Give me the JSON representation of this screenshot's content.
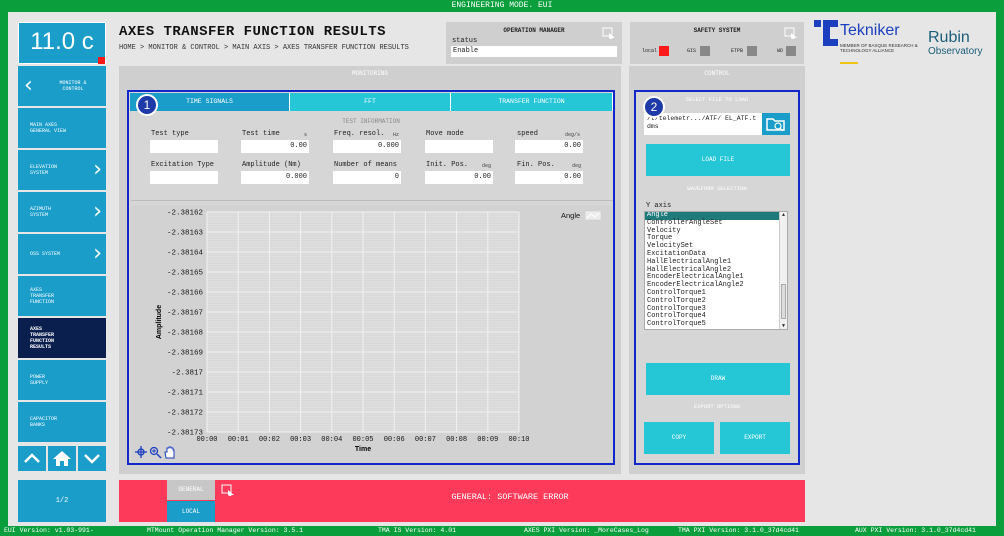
{
  "top_bar": {
    "title": "ENGINEERING MODE. EUI"
  },
  "temperature": {
    "value": "11.0 c"
  },
  "nav": {
    "items": [
      {
        "label": "MONITOR & CONTROL",
        "chevron_left": true
      },
      {
        "label": "MAIN AXES GENERAL VIEW"
      },
      {
        "label": "ELEVATION SYSTEM",
        "chevron": true
      },
      {
        "label": "AZIMUTH SYSTEM",
        "chevron": true
      },
      {
        "label": "OSS SYSTEM",
        "chevron": true
      },
      {
        "label": "AXES TRANSFER FUNCTION"
      },
      {
        "label": "AXES TRANSFER FUNCTION RESULTS",
        "active": true
      },
      {
        "label": "POWER SUPPLY"
      },
      {
        "label": "CAPACITOR BANKS"
      }
    ],
    "page_indicator": "1/2"
  },
  "header": {
    "title": "AXES TRANSFER FUNCTION RESULTS",
    "breadcrumb": "HOME > MONITOR & CONTROL > MAIN AXIS > AXES TRANSFER FUNCTION RESULTS"
  },
  "operation_manager": {
    "title": "OPERATION MANAGER",
    "status_label": "status",
    "status_value": "Enable"
  },
  "safety_system": {
    "title": "SAFETY SYSTEM",
    "items": [
      {
        "label": "local",
        "color": "#ff1a1a"
      },
      {
        "label": "GIS",
        "color": "#8a8a8a"
      },
      {
        "label": "ETPB",
        "color": "#8a8a8a"
      },
      {
        "label": "WD",
        "color": "#8a8a8a"
      }
    ]
  },
  "logos": {
    "tekniker_name": "Tekniker",
    "tekniker_sub": "MEMBER OF BASQUE RESEARCH & TECHNOLOGY ALLIANCE",
    "rubin_line1": "Rubin",
    "rubin_line2": "Observatory"
  },
  "monitoring": {
    "panel_title": "MONITORING",
    "marker": "1",
    "tabs": [
      "TIME SIGNALS",
      "FFT",
      "TRANSFER FUNCTION"
    ],
    "test_info_title": "TEST INFORMATION",
    "fields": {
      "test_type": {
        "label": "Test type",
        "value": ""
      },
      "test_time": {
        "label": "Test time",
        "unit": "s",
        "value": "0.00"
      },
      "freq_resol": {
        "label": "Freq. resol.",
        "unit": "Hz",
        "value": "0.000"
      },
      "move_mode": {
        "label": "Move mode",
        "value": ""
      },
      "speed": {
        "label": "speed",
        "unit": "deg/s",
        "value": "0.00"
      },
      "excitation_type": {
        "label": "Excitation Type",
        "value": ""
      },
      "amplitude": {
        "label": "Amplitude (Nm)",
        "value": "0.000"
      },
      "num_means": {
        "label": "Number of means",
        "value": "0"
      },
      "init_pos": {
        "label": "Init. Pos.",
        "unit": "deg",
        "value": "0.00"
      },
      "fin_pos": {
        "label": "Fin. Pos.",
        "unit": "deg",
        "value": "0.00"
      }
    }
  },
  "chart_data": {
    "type": "line",
    "xlabel": "Time",
    "ylabel": "Amplitude",
    "legend": [
      "Angle"
    ],
    "legend_placement": "top-right",
    "grid": true,
    "yticks": [
      "-2.38162",
      "-2.38163",
      "-2.38164",
      "-2.38165",
      "-2.38166",
      "-2.38167",
      "-2.38168",
      "-2.38169",
      "-2.3817",
      "-2.38171",
      "-2.38172",
      "-2.38173"
    ],
    "xticks": [
      "00:00",
      "00:01",
      "00:02",
      "00:03",
      "00:04",
      "00:05",
      "00:06",
      "00:07",
      "00:08",
      "00:09",
      "00:10"
    ],
    "series": []
  },
  "control": {
    "panel_title": "CONTROL",
    "marker": "2",
    "select_file_title": "SELECT FILE TO LOAD",
    "file_path": "/t/telemetr.../ATF/ EL_ATF.tdms",
    "load_file": "LOAD FILE",
    "waveform_title": "WAVEFORM SELECTION",
    "y_axis_label": "Y axis",
    "y_axis_options": [
      "Angle",
      "ControllerAngleSet",
      "Velocity",
      "Torque",
      "VelocitySet",
      "ExcitationData",
      "HallElectricalAngle1",
      "HallElectricalAngle2",
      "EncoderElectricalAngle1",
      "EncoderElectricalAngle2",
      "ControlTorque1",
      "ControlTorque2",
      "ControlTorque3",
      "ControlTorque4",
      "ControlTorque5"
    ],
    "selected_option": "Angle",
    "draw": "DRAW",
    "export_title": "EXPORT OPTIONS",
    "copy": "COPY",
    "export": "EXPORT"
  },
  "general_bar": {
    "tab_general": "GENERAL",
    "tab_local": "LOCAL",
    "message": "GENERAL: SOFTWARE ERROR"
  },
  "footer": {
    "eui_version": "EUI Version: v1.03-991-",
    "mtmount": "MTMount Operation Manager Version: 3.5.1",
    "tma_is": "TMA IS Version: 4.01",
    "axes_pxi": "AXES PXI Version: _MoreCases_Log",
    "tma_pxi": "TMA PXI Version: 3.1.0_37d4cd41",
    "aux_pxi": "AUX PXI Version: 3.1.0_37d4cd41"
  }
}
